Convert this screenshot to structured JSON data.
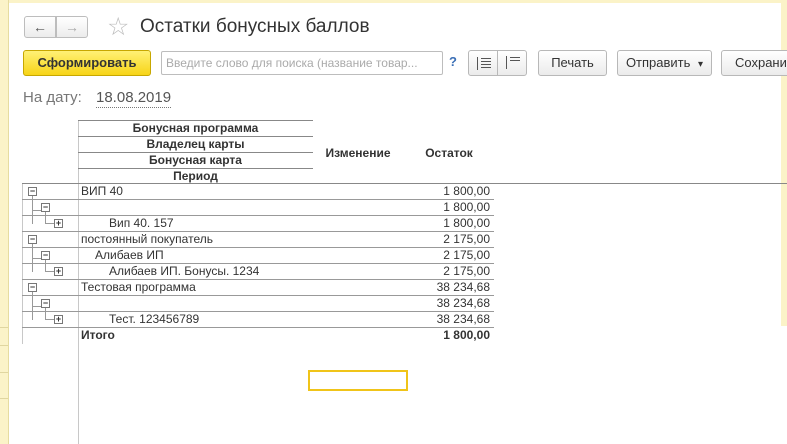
{
  "window": {
    "title": "Остатки бонусных баллов",
    "nav_back_icon": "←",
    "nav_forward_icon": "→",
    "favorite_icon": "☆"
  },
  "toolbar": {
    "generate_label": "Сформировать",
    "search_placeholder": "Введите слово для поиска (название товар...",
    "help_label": "?",
    "print_label": "Печать",
    "send_label": "Отправить",
    "send_arrow": "▾",
    "save_label": "Сохранит"
  },
  "filter": {
    "date_label": "На дату:",
    "date_value": "18.08.2019"
  },
  "table": {
    "group_headers": [
      "Бонусная программа",
      "Владелец карты",
      "Бонусная карта",
      "Период"
    ],
    "col_change": "Изменение",
    "col_balance": "Остаток",
    "rows": [
      {
        "label": "ВИП 40",
        "value": "1 800,00",
        "level": 0,
        "toggle": "−"
      },
      {
        "label": "",
        "value": "1 800,00",
        "level": 1,
        "toggle": "−"
      },
      {
        "label": "Вип 40. 157",
        "value": "1 800,00",
        "level": 2,
        "toggle": "+"
      },
      {
        "label": "постоянный покупатель",
        "value": "2 175,00",
        "level": 0,
        "toggle": "−"
      },
      {
        "label": "Алибаев ИП",
        "value": "2 175,00",
        "level": 1,
        "toggle": "−"
      },
      {
        "label": "Алибаев ИП. Бонусы. 1234",
        "value": "2 175,00",
        "level": 2,
        "toggle": "+"
      },
      {
        "label": "Тестовая программа",
        "value": "38 234,68",
        "level": 0,
        "toggle": "−"
      },
      {
        "label": "",
        "value": "38 234,68",
        "level": 1,
        "toggle": "−"
      },
      {
        "label": "Тест. 123456789",
        "value": "38 234,68",
        "level": 2,
        "toggle": "+"
      }
    ],
    "total": {
      "label": "Итого",
      "value": "1 800,00"
    }
  }
}
